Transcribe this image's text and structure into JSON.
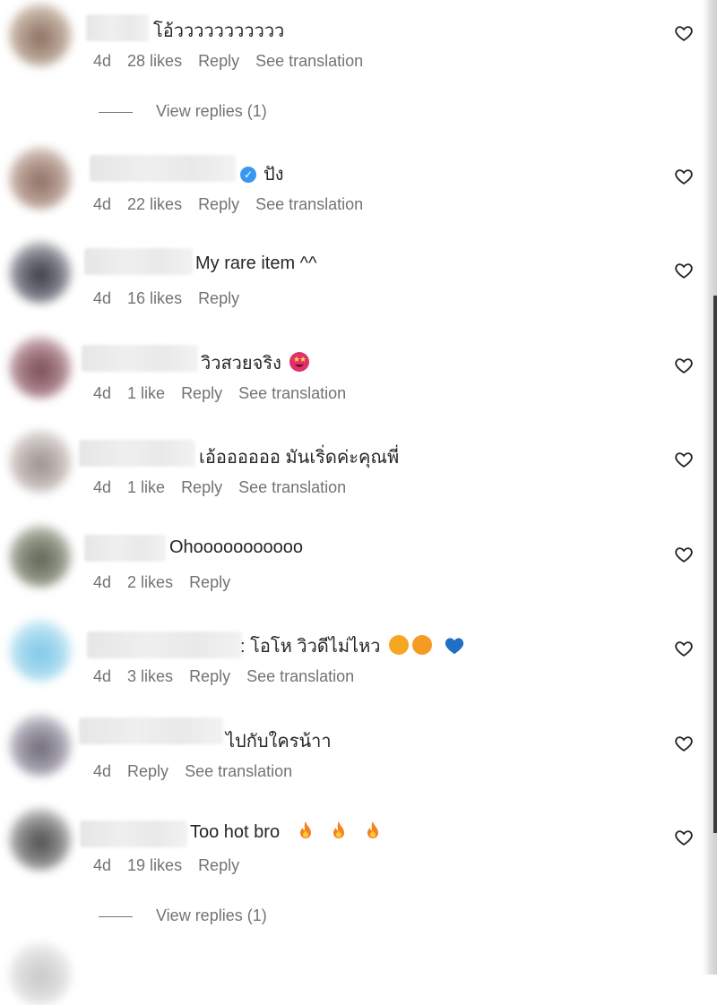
{
  "comments": [
    {
      "text": "โอ้ววววววววววว",
      "time": "4d",
      "likes": "28 likes",
      "reply": "Reply",
      "translate": "See translation",
      "view_replies": "View replies (1)"
    },
    {
      "text": "ปัง",
      "time": "4d",
      "likes": "22 likes",
      "reply": "Reply",
      "translate": "See translation"
    },
    {
      "text": "My rare item ^^",
      "time": "4d",
      "likes": "16 likes",
      "reply": "Reply"
    },
    {
      "text": "วิวสวยจริง",
      "time": "4d",
      "likes": "1 like",
      "reply": "Reply",
      "translate": "See translation"
    },
    {
      "text": "เอ้ออออออ มันเริ่ดค่ะคุณพี่",
      "time": "4d",
      "likes": "1 like",
      "reply": "Reply",
      "translate": "See translation"
    },
    {
      "text": "Ohooooooooooo",
      "time": "4d",
      "likes": "2 likes",
      "reply": "Reply"
    },
    {
      "text": ": โอโห วิวดีไม่ไหว",
      "time": "4d",
      "likes": "3 likes",
      "reply": "Reply",
      "translate": "See translation"
    },
    {
      "text": "ไปกับใครน้าา",
      "time": "4d",
      "reply": "Reply",
      "translate": "See translation"
    },
    {
      "text": "Too hot bro",
      "time": "4d",
      "likes": "19 likes",
      "reply": "Reply",
      "view_replies": "View replies (1)"
    }
  ],
  "colors": {
    "text": "#262626",
    "meta": "#737373",
    "verified": "#3897f0"
  },
  "icons": {
    "like": "heart-outline-icon",
    "verified": "verified-badge-icon"
  }
}
